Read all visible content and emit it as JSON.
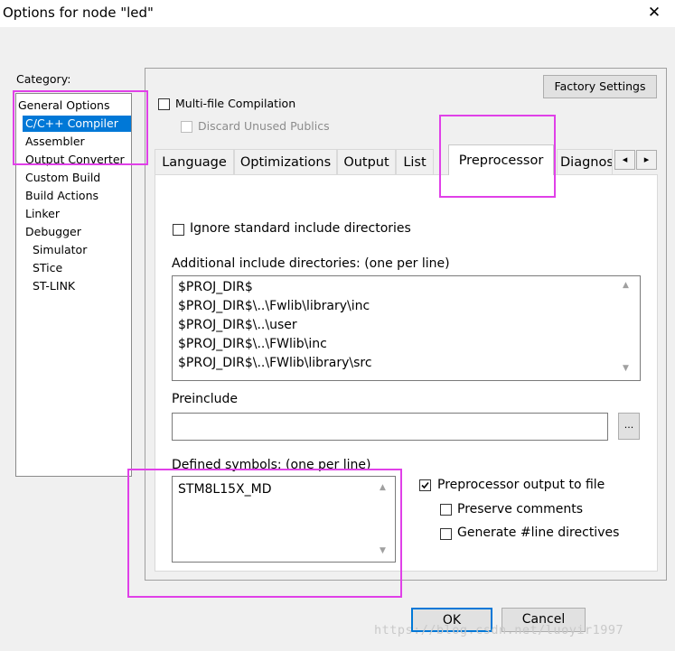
{
  "window": {
    "title": "Options for node \"led\"",
    "close_glyph": "✕"
  },
  "category": {
    "label": "Category:",
    "items": [
      "General Options",
      "C/C++ Compiler",
      "Assembler",
      "Output Converter",
      "Custom Build",
      "Build Actions",
      "Linker",
      "Debugger",
      "Simulator",
      "STice",
      "ST-LINK"
    ],
    "selected": "C/C++ Compiler"
  },
  "panel": {
    "factory_settings": "Factory Settings",
    "multi_file": {
      "label": "Multi-file Compilation",
      "checked": false
    },
    "discard_unused": {
      "label": "Discard Unused Publics",
      "checked": false,
      "enabled": false
    }
  },
  "tabs": {
    "items": [
      "Language",
      "Optimizations",
      "Output",
      "List",
      "Preprocessor",
      "Diagnos"
    ],
    "active": "Preprocessor",
    "scroll_left": "◂",
    "scroll_right": "▸"
  },
  "preprocessor": {
    "ignore_std": {
      "label": "Ignore standard include directories",
      "checked": false
    },
    "include_label": "Additional include directories: (one per line)",
    "include_dirs": [
      "$PROJ_DIR$",
      "$PROJ_DIR$\\..\\Fwlib\\library\\inc",
      "$PROJ_DIR$\\..\\user",
      "$PROJ_DIR$\\..\\FWlib\\inc",
      "$PROJ_DIR$\\..\\FWlib\\library\\src"
    ],
    "preinclude_label": "Preinclude",
    "preinclude_value": "",
    "browse_button": "...",
    "defined_label": "Defined symbols: (one per line)",
    "defined_symbols": [
      "STM8L15X_MD"
    ],
    "pp_output": {
      "label": "Preprocessor output to file",
      "checked": true
    },
    "preserve_comments": {
      "label": "Preserve comments",
      "checked": false
    },
    "line_directives": {
      "label": "Generate #line directives",
      "checked": false
    }
  },
  "buttons": {
    "ok": "OK",
    "cancel": "Cancel"
  },
  "watermark": "https://blog.csdn.net/luoyir1997",
  "colors": {
    "selection": "#0078d7",
    "highlight_box": "#e040e8",
    "default_button_border": "#0078d7"
  }
}
